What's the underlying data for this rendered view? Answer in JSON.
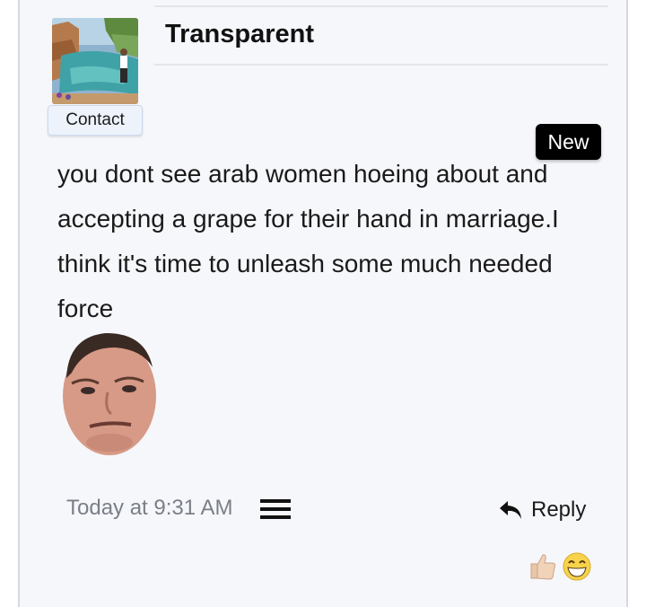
{
  "post": {
    "author": "Transparent",
    "contact_label": "Contact",
    "badge": "New",
    "message": "you dont see arab women hoeing about and accepting a grape for their hand in marriage.I think it's time to unleash some much needed force",
    "timestamp": "Today at 9:31 AM",
    "reply_label": "Reply"
  },
  "icons": {
    "menu": "hamburger-menu-icon",
    "reply": "reply-arrow-icon",
    "reactions": [
      "thumbs-up-icon",
      "laughing-face-icon"
    ]
  },
  "colors": {
    "post_background": "#f6f7fb",
    "badge_background": "#000000",
    "timestamp_text": "#7a7f87",
    "contact_button": "#eef3fb"
  }
}
